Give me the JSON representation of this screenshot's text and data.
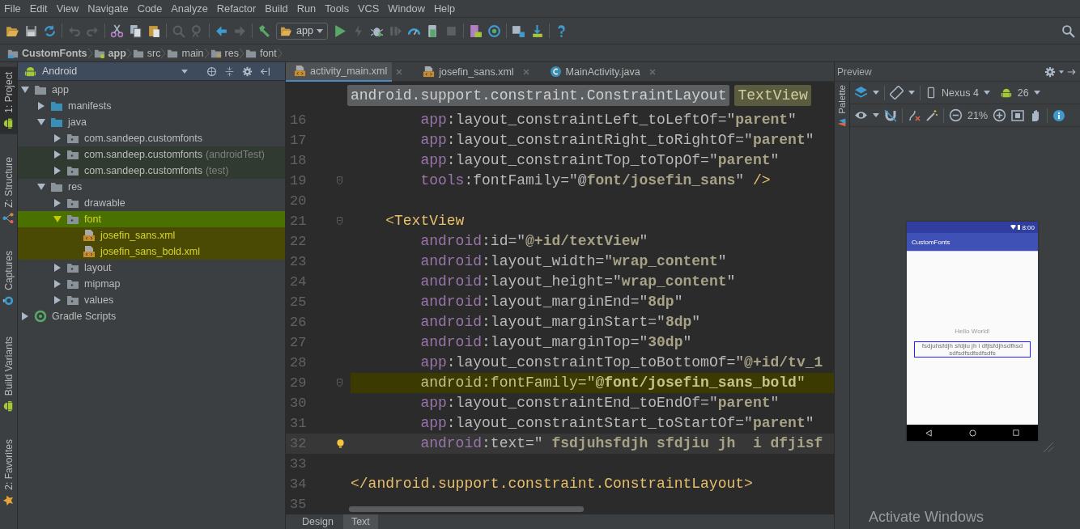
{
  "menu": [
    "File",
    "Edit",
    "View",
    "Navigate",
    "Code",
    "Analyze",
    "Refactor",
    "Build",
    "Run",
    "Tools",
    "VCS",
    "Window",
    "Help"
  ],
  "toolbar": {
    "run_config": "app"
  },
  "breadcrumb": [
    {
      "label": "CustomFonts",
      "kind": "project"
    },
    {
      "label": "app",
      "kind": "module"
    },
    {
      "label": "src",
      "kind": "folder"
    },
    {
      "label": "main",
      "kind": "folder"
    },
    {
      "label": "res",
      "kind": "res"
    },
    {
      "label": "font",
      "kind": "folder"
    }
  ],
  "tool_windows_top": [
    {
      "label": "1: Project",
      "kind": "project",
      "selected": true
    },
    {
      "label": "Z: Structure",
      "kind": "structure",
      "selected": false
    },
    {
      "label": "Captures",
      "kind": "captures",
      "selected": false
    }
  ],
  "tool_windows_bottom": [
    {
      "label": "Build Variants",
      "kind": "variants",
      "selected": false
    },
    {
      "label": "2: Favorites",
      "kind": "favorites",
      "selected": false
    }
  ],
  "project_panel": {
    "view": "Android",
    "tree": [
      {
        "label": "app",
        "kind": "module",
        "expanded": true,
        "marked": false,
        "children": [
          {
            "label": "manifests",
            "kind": "source",
            "expanded": false,
            "marked": false
          },
          {
            "label": "java",
            "kind": "source",
            "expanded": true,
            "marked": false,
            "children": [
              {
                "label": "com.sandeep.customfonts",
                "kind": "package",
                "expanded": false,
                "marked": false
              },
              {
                "label": "com.sandeep.customfonts",
                "suffix": "(androidTest)",
                "kind": "package",
                "expanded": false,
                "marked": false,
                "color": "#313a30"
              },
              {
                "label": "com.sandeep.customfonts",
                "suffix": "(test)",
                "kind": "package",
                "expanded": false,
                "marked": false,
                "color": "#313a30"
              }
            ]
          },
          {
            "label": "res",
            "kind": "res",
            "expanded": true,
            "marked": false,
            "children": [
              {
                "label": "drawable",
                "kind": "package",
                "expanded": false,
                "marked": false
              },
              {
                "label": "font",
                "kind": "package",
                "expanded": true,
                "marked": true,
                "color": "#4a7000",
                "children": [
                  {
                    "label": "josefin_sans.xml",
                    "kind": "file",
                    "marked": true,
                    "color": "#4b4a05"
                  },
                  {
                    "label": "josefin_sans_bold.xml",
                    "kind": "file",
                    "marked": true,
                    "color": "#4b4a05"
                  }
                ]
              },
              {
                "label": "layout",
                "kind": "package",
                "expanded": false,
                "marked": false
              },
              {
                "label": "mipmap",
                "kind": "package",
                "expanded": false,
                "marked": false
              },
              {
                "label": "values",
                "kind": "package",
                "expanded": false,
                "marked": false
              }
            ]
          }
        ]
      },
      {
        "label": "Gradle Scripts",
        "kind": "gradle",
        "expanded": false,
        "marked": false
      }
    ]
  },
  "editor": {
    "tabs": [
      {
        "label": "activity_main.xml",
        "kind": "xml",
        "selected": true
      },
      {
        "label": "josefin_sans.xml",
        "kind": "xml",
        "selected": false
      },
      {
        "label": "MainActivity.java",
        "kind": "java",
        "selected": false
      }
    ],
    "path": [
      {
        "label": "android.support.constraint.ConstraintLayout",
        "selected": false
      },
      {
        "label": "TextView",
        "selected": true
      }
    ],
    "lines": [
      {
        "number": "16",
        "highlighted": false,
        "current": false,
        "fold": false,
        "bulb": false,
        "tokens": [
          {
            "text": "        app",
            "kind": "ns"
          },
          {
            "text": ":layout_constraintLeft_toLeftOf=\"",
            "kind": "plain"
          },
          {
            "text": "parent",
            "kind": "val"
          },
          {
            "text": "\"",
            "kind": "plain"
          }
        ]
      },
      {
        "number": "17",
        "highlighted": false,
        "current": false,
        "fold": false,
        "bulb": false,
        "tokens": [
          {
            "text": "        app",
            "kind": "ns"
          },
          {
            "text": ":layout_constraintRight_toRightOf=\"",
            "kind": "plain"
          },
          {
            "text": "parent",
            "kind": "val"
          },
          {
            "text": "\"",
            "kind": "plain"
          }
        ]
      },
      {
        "number": "18",
        "highlighted": false,
        "current": false,
        "fold": false,
        "bulb": false,
        "tokens": [
          {
            "text": "        app",
            "kind": "ns"
          },
          {
            "text": ":layout_constraintTop_toTopOf=\"",
            "kind": "plain"
          },
          {
            "text": "parent",
            "kind": "val"
          },
          {
            "text": "\"",
            "kind": "plain"
          }
        ]
      },
      {
        "number": "19",
        "highlighted": false,
        "current": false,
        "fold": true,
        "bulb": false,
        "tokens": [
          {
            "text": "        tools",
            "kind": "ns"
          },
          {
            "text": ":fontFamily=\"@",
            "kind": "plain"
          },
          {
            "text": "font/josefin_sans",
            "kind": "val"
          },
          {
            "text": "\"",
            "kind": "plain"
          },
          {
            "text": " />",
            "kind": "tag"
          }
        ]
      },
      {
        "number": "20",
        "highlighted": false,
        "current": false,
        "fold": false,
        "bulb": false
      },
      {
        "number": "21",
        "highlighted": false,
        "current": false,
        "fold": true,
        "bulb": false,
        "tokens": [
          {
            "text": "    <TextView",
            "kind": "tag"
          }
        ]
      },
      {
        "number": "22",
        "highlighted": false,
        "current": false,
        "fold": false,
        "bulb": false,
        "tokens": [
          {
            "text": "        android",
            "kind": "ns"
          },
          {
            "text": ":id=\"",
            "kind": "plain"
          },
          {
            "text": "@+id/textView",
            "kind": "val"
          },
          {
            "text": "\"",
            "kind": "plain"
          }
        ]
      },
      {
        "number": "23",
        "highlighted": false,
        "current": false,
        "fold": false,
        "bulb": false,
        "tokens": [
          {
            "text": "        android",
            "kind": "ns"
          },
          {
            "text": ":layout_width=\"",
            "kind": "plain"
          },
          {
            "text": "wrap_content",
            "kind": "val"
          },
          {
            "text": "\"",
            "kind": "plain"
          }
        ]
      },
      {
        "number": "24",
        "highlighted": false,
        "current": false,
        "fold": false,
        "bulb": false,
        "tokens": [
          {
            "text": "        android",
            "kind": "ns"
          },
          {
            "text": ":layout_height=\"",
            "kind": "plain"
          },
          {
            "text": "wrap_content",
            "kind": "val"
          },
          {
            "text": "\"",
            "kind": "plain"
          }
        ]
      },
      {
        "number": "25",
        "highlighted": false,
        "current": false,
        "fold": false,
        "bulb": false,
        "tokens": [
          {
            "text": "        android",
            "kind": "ns"
          },
          {
            "text": ":layout_marginEnd=\"",
            "kind": "plain"
          },
          {
            "text": "8dp",
            "kind": "val"
          },
          {
            "text": "\"",
            "kind": "plain"
          }
        ]
      },
      {
        "number": "26",
        "highlighted": false,
        "current": false,
        "fold": false,
        "bulb": false,
        "tokens": [
          {
            "text": "        android",
            "kind": "ns"
          },
          {
            "text": ":layout_marginStart=\"",
            "kind": "plain"
          },
          {
            "text": "8dp",
            "kind": "val"
          },
          {
            "text": "\"",
            "kind": "plain"
          }
        ]
      },
      {
        "number": "27",
        "highlighted": false,
        "current": false,
        "fold": false,
        "bulb": false,
        "tokens": [
          {
            "text": "        android",
            "kind": "ns"
          },
          {
            "text": ":layout_marginTop=\"",
            "kind": "plain"
          },
          {
            "text": "30dp",
            "kind": "val"
          },
          {
            "text": "\"",
            "kind": "plain"
          }
        ]
      },
      {
        "number": "28",
        "highlighted": false,
        "current": false,
        "fold": false,
        "bulb": false,
        "tokens": [
          {
            "text": "        app",
            "kind": "ns"
          },
          {
            "text": ":layout_constraintTop_toBottomOf=\"",
            "kind": "plain"
          },
          {
            "text": "@+id/tv_1",
            "kind": "val"
          }
        ]
      },
      {
        "number": "29",
        "highlighted": true,
        "current": false,
        "fold": true,
        "bulb": false,
        "tokens": [
          {
            "text": "        android",
            "kind": "ns"
          },
          {
            "text": ":fontFamily=\"@",
            "kind": "plain"
          },
          {
            "text": "font/josefin_sans_bold",
            "kind": "val"
          },
          {
            "text": "\"",
            "kind": "plain"
          }
        ]
      },
      {
        "number": "30",
        "highlighted": false,
        "current": false,
        "fold": false,
        "bulb": false,
        "tokens": [
          {
            "text": "        app",
            "kind": "ns"
          },
          {
            "text": ":layout_constraintEnd_toEndOf=\"",
            "kind": "plain"
          },
          {
            "text": "parent",
            "kind": "val"
          },
          {
            "text": "\"",
            "kind": "plain"
          }
        ]
      },
      {
        "number": "31",
        "highlighted": false,
        "current": false,
        "fold": false,
        "bulb": false,
        "tokens": [
          {
            "text": "        app",
            "kind": "ns"
          },
          {
            "text": ":layout_constraintStart_toStartOf=\"",
            "kind": "plain"
          },
          {
            "text": "parent",
            "kind": "val"
          },
          {
            "text": "\"",
            "kind": "plain"
          }
        ]
      },
      {
        "number": "32",
        "highlighted": false,
        "current": true,
        "fold": false,
        "bulb": true,
        "tokens": [
          {
            "text": "        android",
            "kind": "ns"
          },
          {
            "text": ":text=\"",
            "kind": "plain"
          },
          {
            "text": " fsdjuhsfdjh sfdjiu jh  i dfjisf",
            "kind": "val"
          }
        ]
      },
      {
        "number": "33",
        "highlighted": false,
        "current": false,
        "fold": false,
        "bulb": false
      },
      {
        "number": "34",
        "highlighted": false,
        "current": false,
        "fold": false,
        "bulb": false,
        "tokens": [
          {
            "text": "</android.support.constraint.ConstraintLayout>",
            "kind": "tag"
          }
        ]
      },
      {
        "number": "35",
        "highlighted": false,
        "current": false,
        "fold": false,
        "bulb": false
      }
    ],
    "bottom_tabs": [
      {
        "label": "Design",
        "selected": false
      },
      {
        "label": "Text",
        "selected": true
      }
    ]
  },
  "preview": {
    "title": "Preview",
    "side_tab": "Palette",
    "device": "Nexus 4",
    "api": "26",
    "zoom": "21%",
    "phone": {
      "time": "8:00",
      "app_title": "CustomFonts",
      "views": [
        {
          "text": "Hello World!",
          "selected": false
        },
        {
          "text": "fsdjuhsfdjh sfdjiu jh  i dfjisfdjhsdfhsd   sdfsdfsdfsdfsdfs",
          "selected": true
        }
      ]
    }
  },
  "os_notice": "Activate Windows"
}
